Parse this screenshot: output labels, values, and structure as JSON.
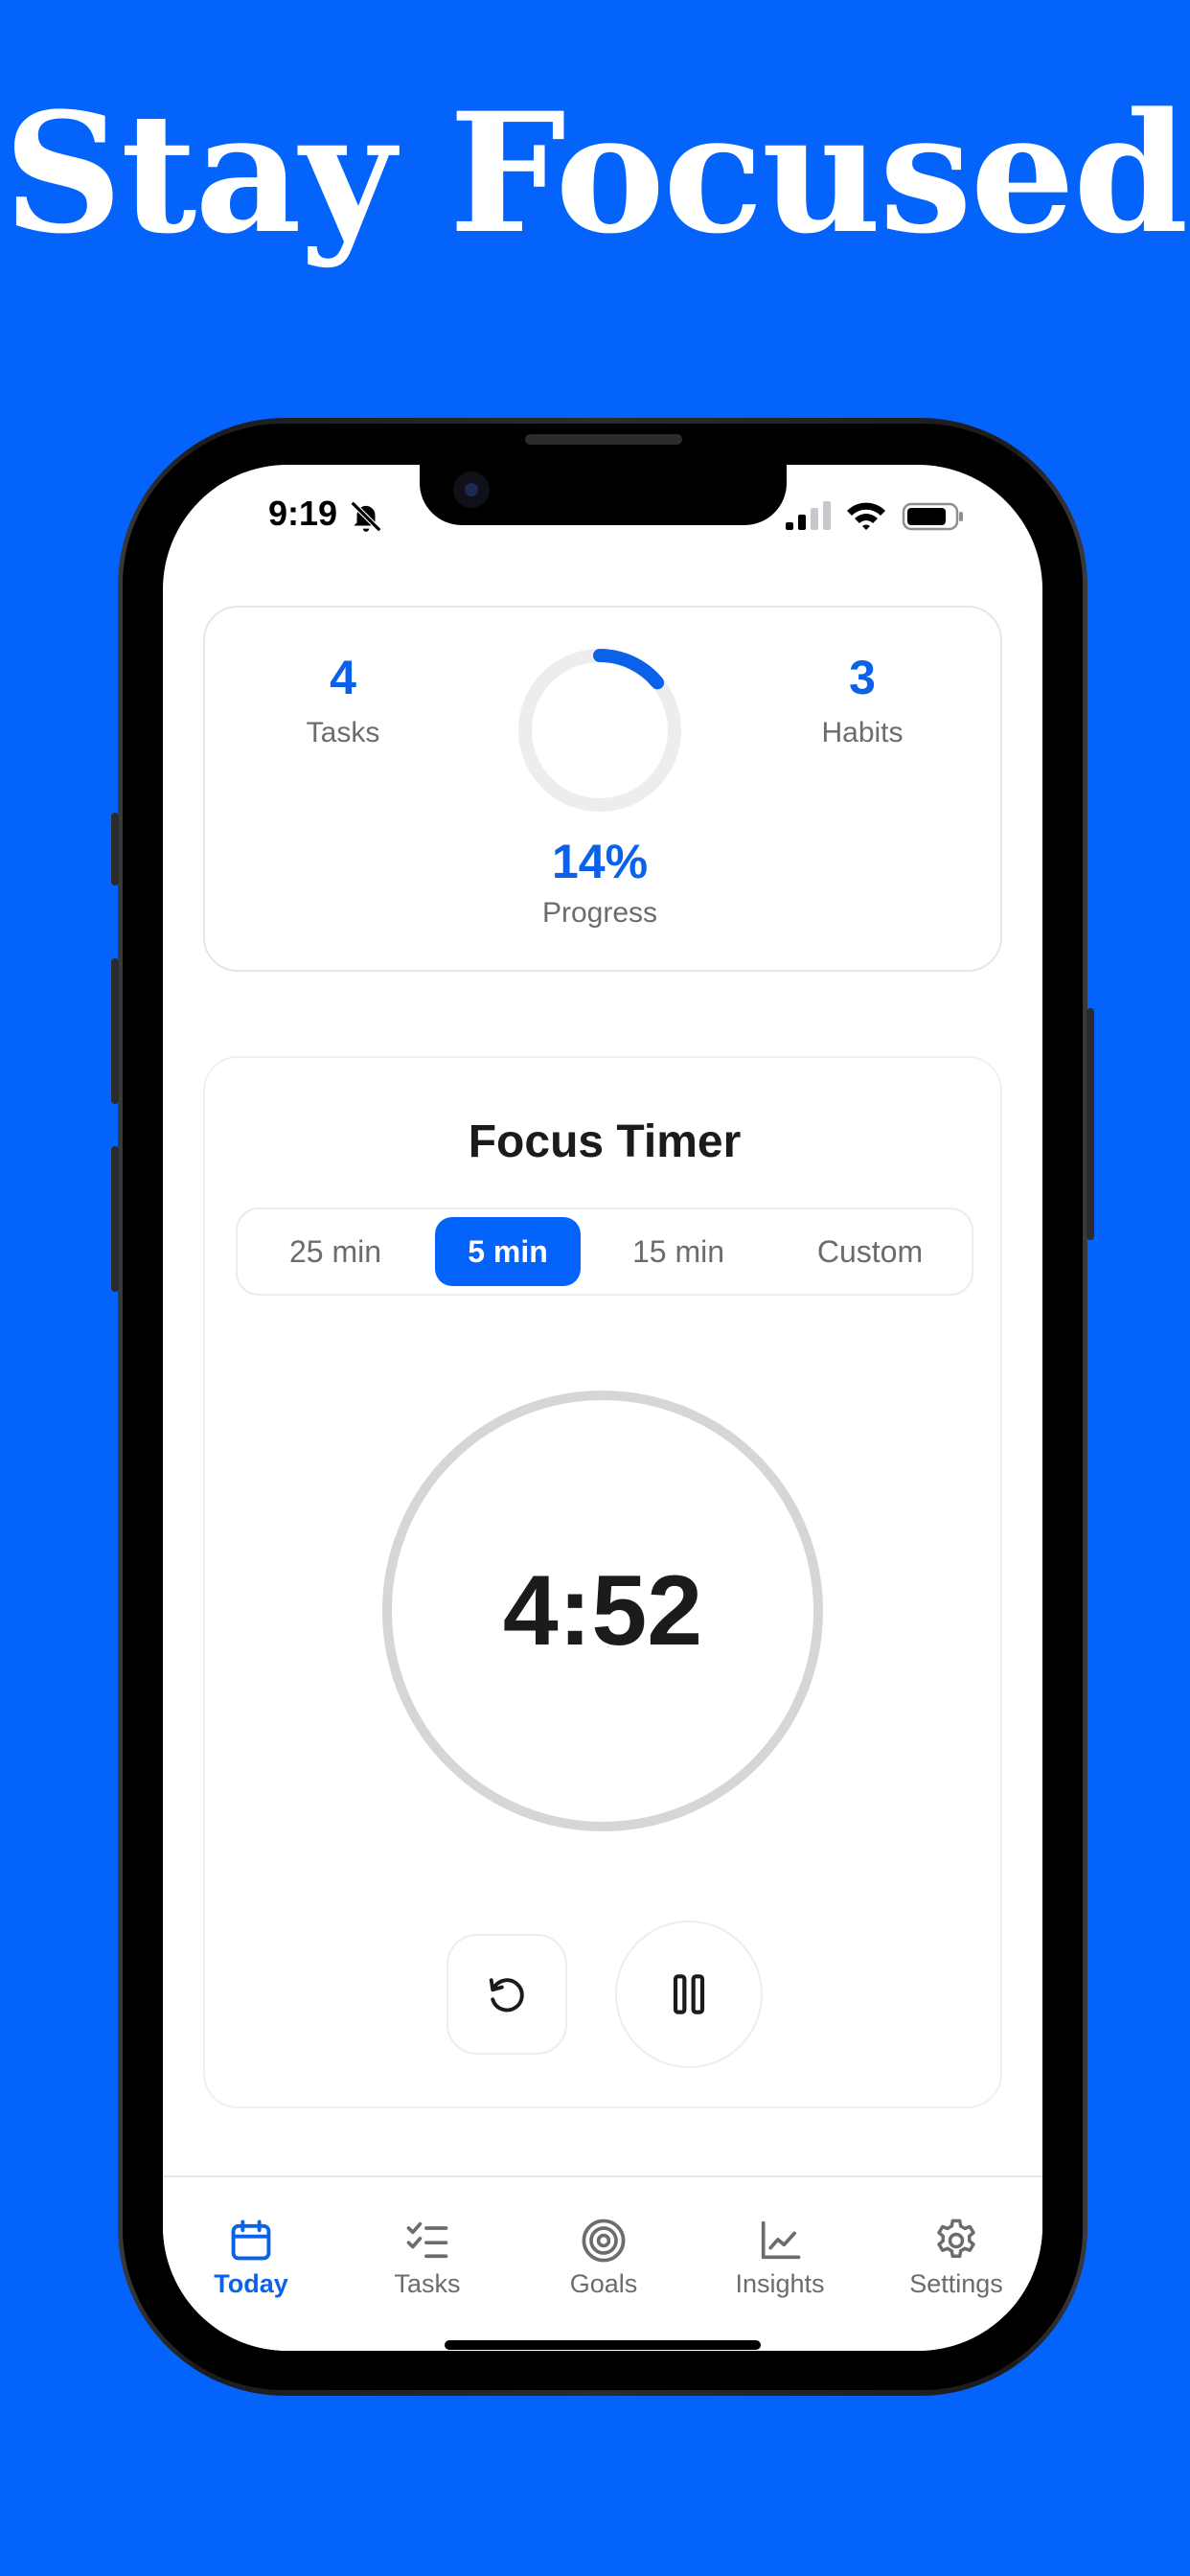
{
  "headline": "Stay Focused",
  "status_bar": {
    "time": "9:19"
  },
  "stats": {
    "tasks": {
      "value": "4",
      "label": "Tasks"
    },
    "habits": {
      "value": "3",
      "label": "Habits"
    },
    "progress": {
      "value": "14%",
      "label": "Progress",
      "fraction": 0.14
    }
  },
  "timer": {
    "title": "Focus Timer",
    "options": [
      {
        "label": "25 min",
        "active": false
      },
      {
        "label": "5 min",
        "active": true
      },
      {
        "label": "15 min",
        "active": false
      },
      {
        "label": "Custom",
        "active": false
      }
    ],
    "remaining": "4:52"
  },
  "tabs": [
    {
      "label": "Today",
      "icon": "calendar-icon",
      "active": true
    },
    {
      "label": "Tasks",
      "icon": "checklist-icon",
      "active": false
    },
    {
      "label": "Goals",
      "icon": "target-icon",
      "active": false
    },
    {
      "label": "Insights",
      "icon": "chart-icon",
      "active": false
    },
    {
      "label": "Settings",
      "icon": "gear-icon",
      "active": false
    }
  ],
  "colors": {
    "background": "#0363fb",
    "accent": "#0b62e8",
    "muted_text": "#6b6b70"
  }
}
